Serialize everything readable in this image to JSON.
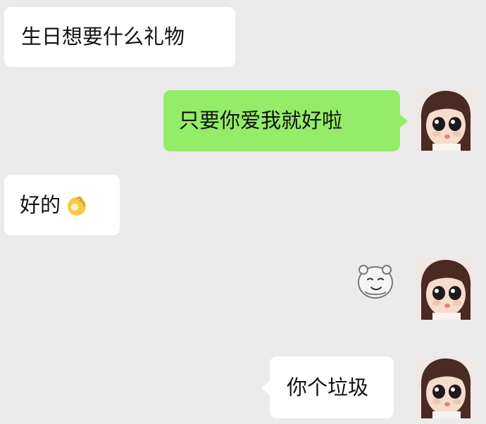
{
  "messages": [
    {
      "id": "msg1",
      "side": "left",
      "text": "生日想要什么礼物"
    },
    {
      "id": "msg2",
      "side": "right",
      "text": "只要你爱我就好啦"
    },
    {
      "id": "msg3",
      "side": "left",
      "text": "好的",
      "emoji": "ok-hand-emoji"
    },
    {
      "id": "msg4",
      "side": "right",
      "sticker": "bear-face-sticker"
    },
    {
      "id": "msg5",
      "side": "right",
      "text": "你个垃圾"
    }
  ],
  "colors": {
    "background": "#ebebeb",
    "incoming_bubble": "#ffffff",
    "outgoing_bubble": "#95ec69",
    "text": "#111111"
  },
  "icons": {
    "avatar": "doll-avatar",
    "ok_emoji": "ok-hand-emoji",
    "sticker": "bear-face-sticker"
  }
}
